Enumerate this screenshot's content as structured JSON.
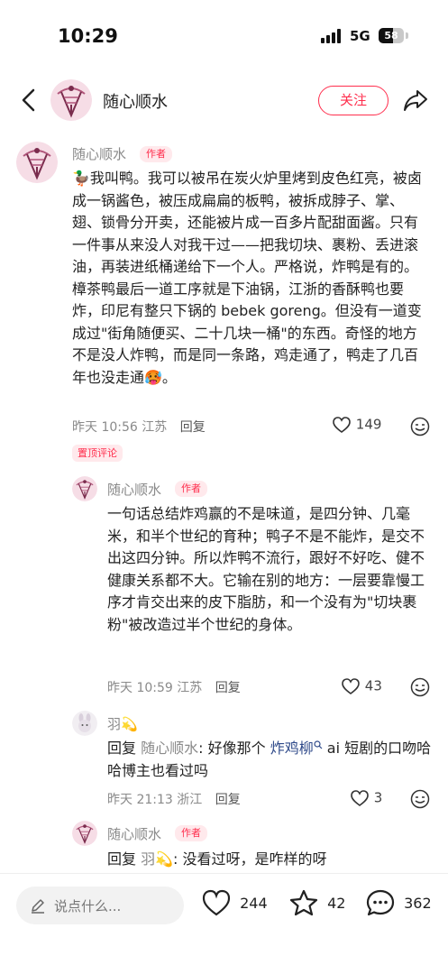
{
  "status_bar": {
    "time": "10:29",
    "network": "5G",
    "battery": "58",
    "battery_level": 0.58
  },
  "header": {
    "author_name": "随心顺水",
    "follow_label": "关注"
  },
  "main_comment": {
    "author": "随心顺水",
    "tag": "作者",
    "text": "🦆我叫鸭。我可以被吊在炭火炉里烤到皮色红亮，被卤成一锅酱色，被压成扁扁的板鸭，被拆成脖子、掌、翅、锁骨分开卖，还能被片成一百多片配甜面酱。只有一件事从来没人对我干过——把我切块、裹粉、丢进滚油，再装进纸桶递给下一个人。严格说，炸鸭是有的。樟茶鸭最后一道工序就是下油锅，江浙的香酥鸭也要炸，印尼有整只下锅的 bebek goreng。但没有一道变成过\"街角随便买、二十几块一桶\"的东西。奇怪的地方不是没人炸鸭，而是同一条路，鸡走通了，鸭走了几百年也没走通🥵。",
    "time": "昨天 10:56",
    "location": "江苏",
    "reply_label": "回复",
    "likes": "149",
    "pinned_label": "置顶评论"
  },
  "replies": [
    {
      "author": "随心顺水",
      "tag": "作者",
      "text": "一句话总结炸鸡赢的不是味道，是四分钟、几毫米，和半个世纪的育种；鸭子不是不能炸，是交不出这四分钟。所以炸鸭不流行，跟好不好吃、健不健康关系都不大。它输在别的地方：一层要靠慢工序才肯交出来的皮下脂肪，和一个没有为\"切块裹粉\"被改造过半个世纪的身体。",
      "time": "昨天 10:59",
      "location": "江苏",
      "reply_label": "回复",
      "likes": "43"
    },
    {
      "author": "羽💫",
      "prefix": "回复",
      "reply_to": "随心顺水",
      "text_before": ": 好像那个 ",
      "mention": "炸鸡柳",
      "text_after": " ai 短剧的口吻哈哈博主也看过吗",
      "time": "昨天 21:13",
      "location": "浙江",
      "reply_label": "回复",
      "likes": "3"
    },
    {
      "author": "随心顺水",
      "tag": "作者",
      "prefix": "回复",
      "reply_to": "羽💫",
      "text_after": ": 没看过呀，是咋样的呀"
    }
  ],
  "bottom_bar": {
    "placeholder": "说点什么...",
    "likes": "244",
    "favorites": "42",
    "comments": "362"
  },
  "colors": {
    "accent": "#ff2e4d",
    "meta": "#8a8a8a",
    "mention": "#2f4a8a"
  }
}
